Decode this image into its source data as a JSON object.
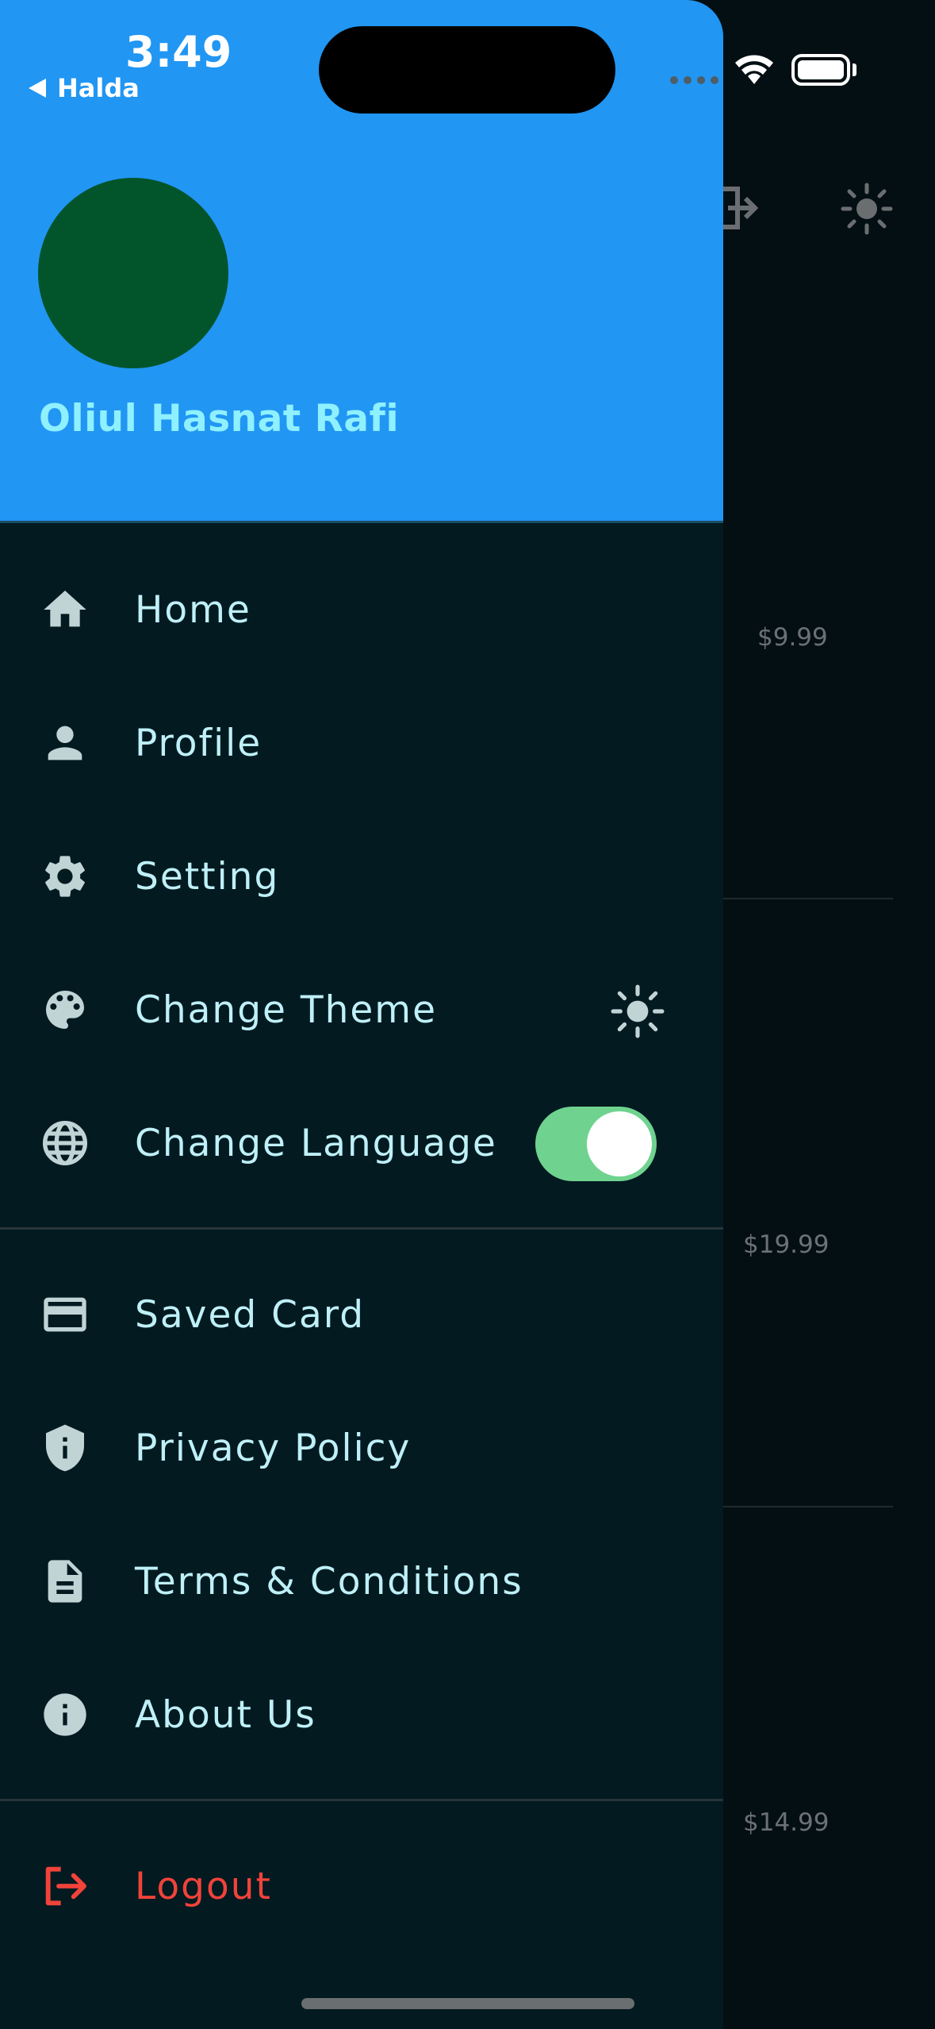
{
  "status_bar": {
    "time": "3:49",
    "back_label": "Halda"
  },
  "background": {
    "prices": [
      "$9.99",
      "$19.99",
      "$14.99"
    ]
  },
  "drawer": {
    "user_name": "Oliul Hasnat Rafi",
    "colors": {
      "header": "#2196f3",
      "avatar": "#02542b",
      "body": "#031a21",
      "logout": "#f0433a",
      "switch_on": "#6fd38f"
    },
    "items": [
      {
        "label": "Home",
        "icon": "home-icon"
      },
      {
        "label": "Profile",
        "icon": "person-icon"
      },
      {
        "label": "Setting",
        "icon": "gear-icon"
      },
      {
        "label": "Change Theme",
        "icon": "palette-icon",
        "trailing": "sun-icon"
      },
      {
        "label": "Change Language",
        "icon": "globe-icon",
        "trailing": "switch",
        "switch_on": true
      },
      {
        "label": "Saved Card",
        "icon": "credit-card-icon"
      },
      {
        "label": "Privacy Policy",
        "icon": "shield-icon"
      },
      {
        "label": "Terms & Conditions",
        "icon": "document-icon"
      },
      {
        "label": "About Us",
        "icon": "info-icon"
      }
    ],
    "logout_label": "Logout"
  }
}
